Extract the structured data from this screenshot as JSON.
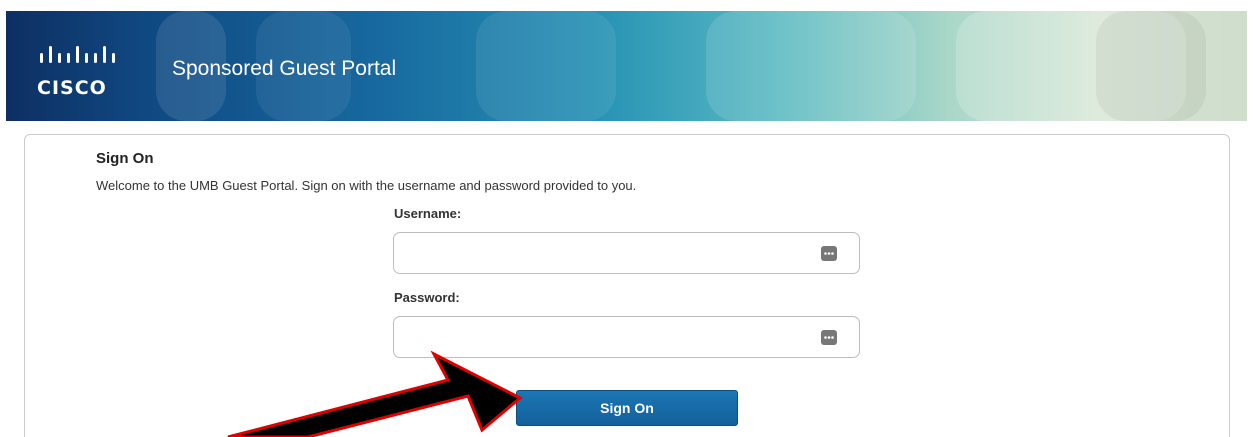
{
  "header": {
    "logo_word": "CISCO",
    "title": "Sponsored Guest Portal"
  },
  "form": {
    "heading": "Sign On",
    "welcome_text": "Welcome to the UMB Guest Portal. Sign on with the username and password provided to you.",
    "username_label": "Username:",
    "username_value": "",
    "password_label": "Password:",
    "password_value": "",
    "field_icon": "password-manager-icon",
    "submit_label": "Sign On"
  },
  "annotation": {
    "icon": "arrow-pointer-icon"
  },
  "colors": {
    "header_dark": "#0d2f63",
    "header_light": "#d6e6d4",
    "button": "#1a6fae",
    "arrow_fill": "#000000",
    "arrow_outline": "#e00000"
  }
}
